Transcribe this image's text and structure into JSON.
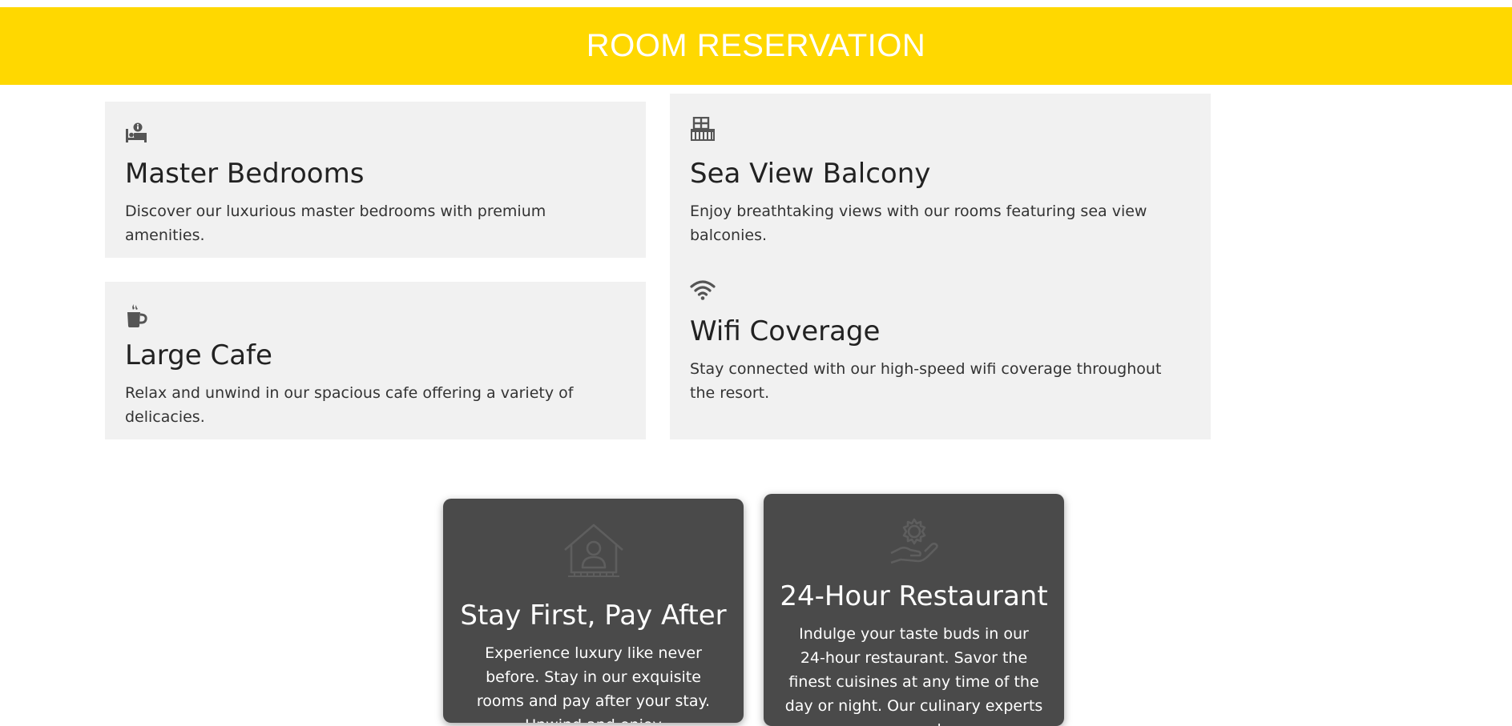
{
  "banner": {
    "title": "ROOM RESERVATION"
  },
  "features": [
    {
      "icon": "bed-icon",
      "title": "Master Bedrooms",
      "text": "Discover our luxurious master bedrooms with premium amenities."
    },
    {
      "icon": "balcony-icon",
      "title": "Sea View Balcony",
      "text": "Enjoy breathtaking views with our rooms featuring sea view balconies."
    },
    {
      "icon": "coffee-icon",
      "title": "Large Cafe",
      "text": "Relax and unwind in our spacious cafe offering a variety of delicacies."
    },
    {
      "icon": "wifi-icon",
      "title": "Wifi Coverage",
      "text": "Stay connected with our high-speed wifi coverage throughout the resort."
    }
  ],
  "highlights": [
    {
      "icon": "home-person-icon",
      "title": "Stay First, Pay After",
      "text": "Experience luxury like never before. Stay in our exquisite rooms and pay after your stay. Unwind and enjoy"
    },
    {
      "icon": "hand-gear-icon",
      "title": "24-Hour Restaurant",
      "text": "Indulge your taste buds in our 24-hour restaurant. Savor the finest cuisines at any time of the day or night. Our culinary experts are ready"
    }
  ]
}
